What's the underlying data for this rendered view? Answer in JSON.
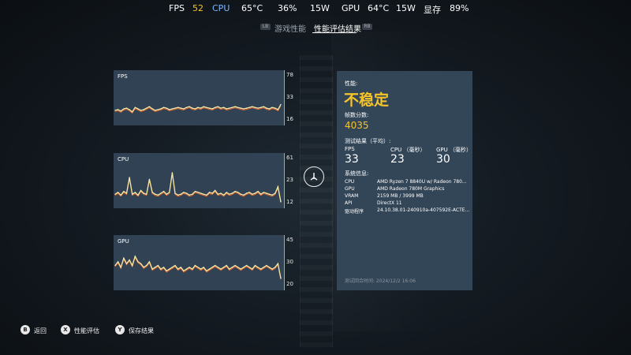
{
  "overlay": {
    "fps_label": "FPS",
    "fps_value": "52",
    "cpu_label": "CPU",
    "cpu_temp": "65°C",
    "cpu_usage": "36%",
    "cpu_power": "15W",
    "gpu_label": "GPU",
    "gpu_temp": "64°C",
    "gpu_power": "15W",
    "vram_label": "显存",
    "vram_usage": "89%",
    "colors": {
      "accent": "#f7c428",
      "cpu_label": "#7ab8ff"
    }
  },
  "tabs": [
    {
      "key": "LB",
      "label": "游戏性能",
      "active": false
    },
    {
      "label": "性能评估结果",
      "active": true,
      "key": "RB"
    }
  ],
  "charts": [
    {
      "label": "FPS",
      "ticks": [
        "78",
        "33",
        "16"
      ]
    },
    {
      "label": "CPU",
      "ticks": [
        "61",
        "23",
        "12"
      ]
    },
    {
      "label": "GPU",
      "ticks": [
        "45",
        "30",
        "20"
      ]
    }
  ],
  "result": {
    "perf_label": "性能:",
    "status": "不稳定",
    "score_label": "帧数分数:",
    "score": "4035",
    "test_label": "测试结果（平均）:",
    "metrics": [
      {
        "label": "FPS",
        "value": "33"
      },
      {
        "label": "CPU （毫秒）",
        "value": "23"
      },
      {
        "label": "GPU （毫秒）",
        "value": "30"
      }
    ],
    "sys_label": "系统信息:",
    "sys": [
      {
        "k": "CPU",
        "v": "AMD Ryzen 7 8840U w/ Radeon 780..."
      },
      {
        "k": "GPU",
        "v": "AMD Radeon 780M Graphics"
      },
      {
        "k": "VRAM",
        "v": "2159 MB / 3999 MB"
      },
      {
        "k": "API",
        "v": "DirectX 11"
      },
      {
        "k": "驱动程序",
        "v": "24.10.38.01-240910a-407592E-ACTE..."
      }
    ],
    "test_time": "测试回合时间:  2024/12/2 16:06"
  },
  "footer": [
    {
      "btn": "B",
      "label": "返回"
    },
    {
      "btn": "X",
      "label": "性能评估"
    },
    {
      "btn": "Y",
      "label": "保存结果"
    }
  ],
  "chart_data": [
    {
      "type": "line",
      "title": "FPS",
      "ylim": [
        16,
        78
      ],
      "yticks": [
        78,
        33,
        16
      ],
      "series": [
        {
          "values": [
            30,
            31,
            29,
            32,
            33,
            31,
            28,
            34,
            32,
            30,
            31,
            33,
            35,
            32,
            30,
            31,
            32,
            34,
            33,
            31,
            32,
            33,
            34,
            33,
            32,
            34,
            35,
            33,
            32,
            34,
            33,
            35,
            34,
            33,
            32,
            34,
            35,
            33,
            34,
            32,
            33,
            34,
            35,
            34,
            33,
            32,
            33,
            34,
            35,
            34,
            33,
            34,
            35,
            33,
            32,
            34,
            33,
            31,
            38
          ]
        }
      ]
    },
    {
      "type": "line",
      "title": "CPU",
      "ylim": [
        12,
        61
      ],
      "yticks": [
        61,
        23,
        12
      ],
      "series": [
        {
          "values": [
            22,
            24,
            21,
            25,
            23,
            40,
            22,
            24,
            21,
            26,
            23,
            22,
            38,
            24,
            22,
            21,
            23,
            25,
            22,
            24,
            45,
            23,
            21,
            22,
            24,
            23,
            21,
            22,
            25,
            24,
            23,
            22,
            21,
            24,
            23,
            26,
            22,
            23,
            21,
            24,
            22,
            23,
            25,
            24,
            22,
            21,
            23,
            24,
            22,
            23,
            25,
            22,
            24,
            23,
            22,
            21,
            23,
            30,
            14
          ]
        }
      ]
    },
    {
      "type": "line",
      "title": "GPU",
      "ylim": [
        20,
        45
      ],
      "yticks": [
        45,
        30,
        20
      ],
      "series": [
        {
          "values": [
            31,
            33,
            30,
            35,
            32,
            34,
            31,
            36,
            33,
            32,
            30,
            31,
            33,
            29,
            30,
            31,
            29,
            30,
            28,
            29,
            30,
            31,
            29,
            30,
            28,
            29,
            30,
            29,
            31,
            30,
            29,
            30,
            28,
            29,
            30,
            31,
            30,
            29,
            30,
            31,
            29,
            30,
            31,
            30,
            29,
            30,
            31,
            30,
            29,
            31,
            30,
            29,
            30,
            31,
            30,
            29,
            30,
            32,
            24
          ]
        }
      ]
    }
  ]
}
